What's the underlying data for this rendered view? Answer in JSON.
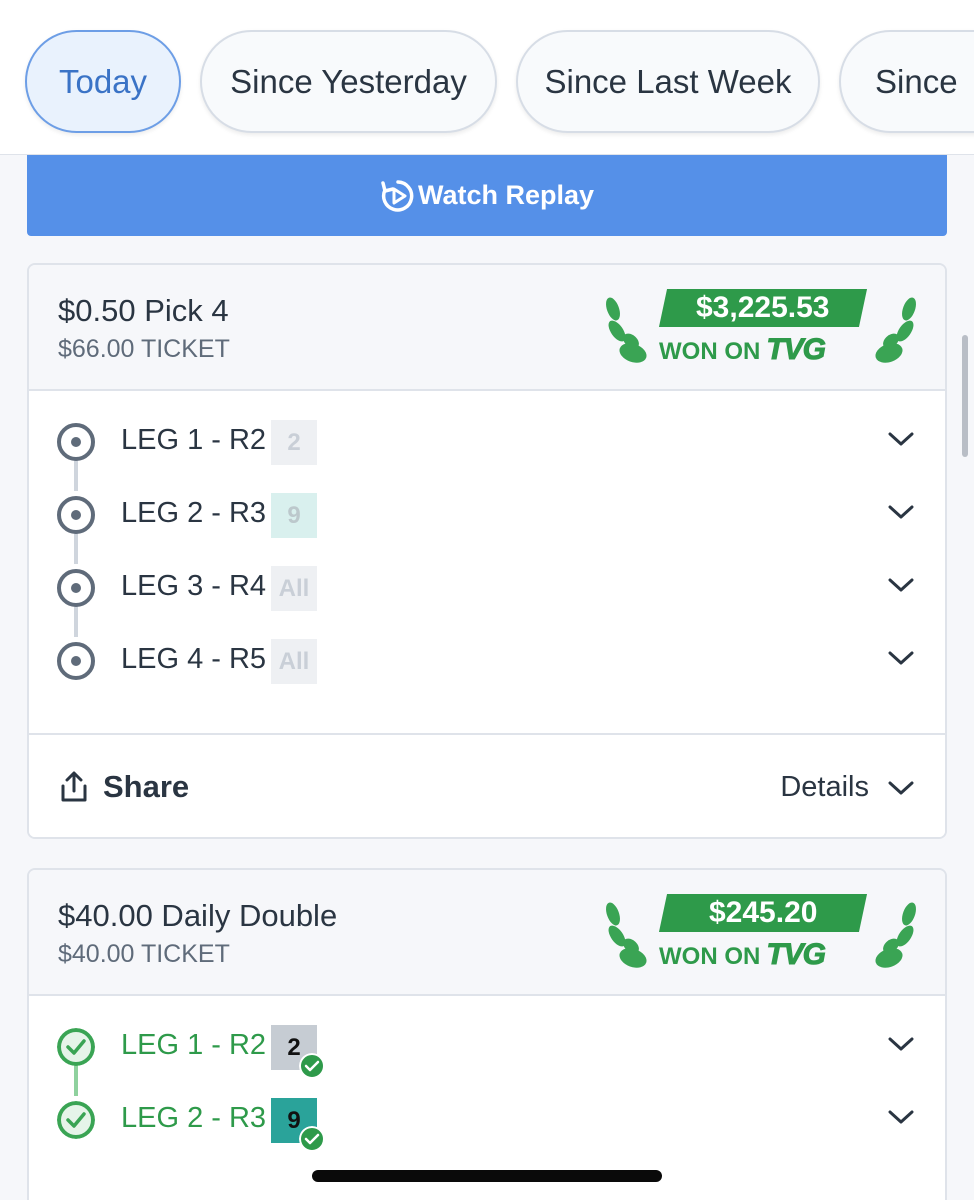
{
  "filters": [
    {
      "label": "Today",
      "active": true
    },
    {
      "label": "Since Yesterday",
      "active": false
    },
    {
      "label": "Since Last Week",
      "active": false
    },
    {
      "label": "Since",
      "active": false
    }
  ],
  "replay_button": {
    "label": "Watch Replay",
    "icon": "replay-icon"
  },
  "bets": [
    {
      "title": "$0.50 Pick 4",
      "ticket": "$66.00 TICKET",
      "won_amount": "$3,225.53",
      "won_label": "WON ON",
      "brand": "TVG",
      "legs": [
        {
          "label": "LEG 1 - R2",
          "selection": "2",
          "status": "open"
        },
        {
          "label": "LEG 2 - R3",
          "selection": "9",
          "status": "open"
        },
        {
          "label": "LEG 3 - R4",
          "selection": "All",
          "status": "open"
        },
        {
          "label": "LEG 4 - R5",
          "selection": "All",
          "status": "open"
        }
      ],
      "footer": {
        "share_label": "Share",
        "details_label": "Details"
      }
    },
    {
      "title": "$40.00 Daily Double",
      "ticket": "$40.00 TICKET",
      "won_amount": "$245.20",
      "won_label": "WON ON",
      "brand": "TVG",
      "legs": [
        {
          "label": "LEG 1 - R2",
          "selection": "2",
          "status": "won"
        },
        {
          "label": "LEG 2 - R3",
          "selection": "9",
          "status": "won"
        }
      ]
    }
  ],
  "colors": {
    "accent_blue": "#5590e8",
    "win_green": "#2e9a4a",
    "border": "#dfe3ea"
  }
}
